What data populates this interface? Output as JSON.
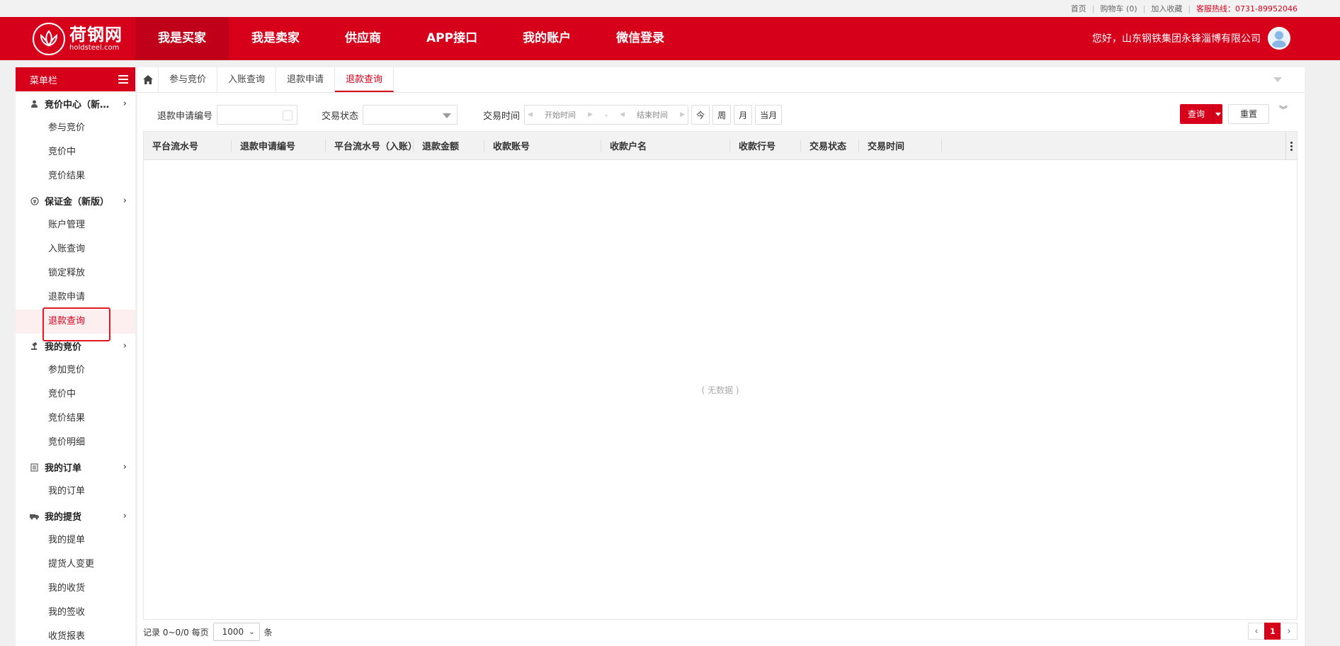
{
  "topbar": {
    "home": "首页",
    "cart": "购物车 (0)",
    "favorite": "加入收藏",
    "hotline": "客服热线：0731-89952046"
  },
  "brand": {
    "name_cn": "荷钢网",
    "name_en": "holdsteel.com"
  },
  "nav": {
    "items": [
      "我是买家",
      "我是卖家",
      "供应商",
      "APP接口",
      "我的账户",
      "微信登录"
    ],
    "active_index": 0
  },
  "user": {
    "greeting": "您好，山东钢铁集团永锋淄博有限公司"
  },
  "sidebar": {
    "title": "菜单栏",
    "groups": [
      {
        "label": "竞价中心（新…",
        "icon": "user-icon",
        "items": [
          "参与竞价",
          "竞价中",
          "竞价结果"
        ]
      },
      {
        "label": "保证金（新版）",
        "icon": "money-circle-icon",
        "items": [
          "账户管理",
          "入账查询",
          "锁定释放",
          "退款申请",
          "退款查询"
        ]
      },
      {
        "label": "我的竞价",
        "icon": "auction-hammer-icon",
        "items": [
          "参加竞价",
          "竞价中",
          "竞价结果",
          "竞价明细"
        ]
      },
      {
        "label": "我的订单",
        "icon": "document-icon",
        "items": [
          "我的订单"
        ]
      },
      {
        "label": "我的提货",
        "icon": "truck-icon",
        "items": [
          "我的提单",
          "提货人变更",
          "我的收货",
          "我的签收",
          "收货报表"
        ]
      }
    ],
    "active_item": "退款查询"
  },
  "tabs": {
    "items": [
      "参与竞价",
      "入账查询",
      "退款申请",
      "退款查询"
    ],
    "active_index": 3
  },
  "filters": {
    "refund_no_label": "退款申请编号",
    "status_label": "交易状态",
    "time_label": "交易时间",
    "start_placeholder": "开始时间",
    "range_sep": "-",
    "end_placeholder": "结束时间",
    "quick": [
      "今",
      "周",
      "月",
      "当月"
    ],
    "search_label": "查询",
    "reset_label": "重置"
  },
  "table": {
    "columns": [
      "平台流水号",
      "退款申请编号",
      "平台流水号（入账）",
      "退款金额",
      "收款账号",
      "收款户名",
      "收款行号",
      "交易状态",
      "交易时间"
    ],
    "empty_text": "( 无数据 )"
  },
  "footer": {
    "records_text": "记录 0~0/0 每页",
    "page_size": "1000",
    "unit": "条",
    "current_page": "1"
  }
}
